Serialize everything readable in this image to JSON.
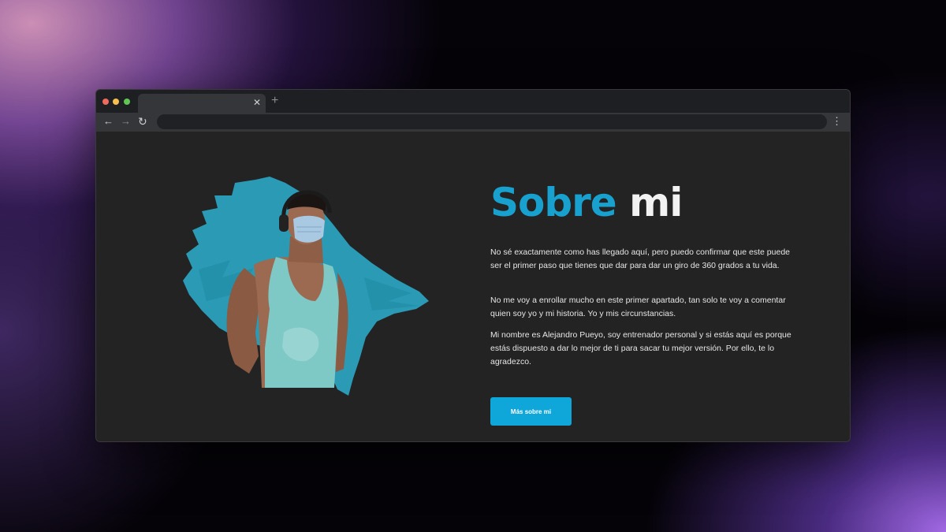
{
  "browser": {
    "tab_close_icon": "close-icon",
    "new_tab_icon": "plus-icon",
    "back_icon": "arrow-left-icon",
    "forward_icon": "arrow-right-icon",
    "reload_icon": "reload-icon",
    "menu_icon": "kebab-menu-icon",
    "tab_close_glyph": "✕",
    "new_tab_glyph": "+",
    "back_glyph": "←",
    "forward_glyph": "→",
    "reload_glyph": "↻",
    "menu_glyph": "⋮"
  },
  "about": {
    "title_part1": "Sobre",
    "title_part2": "mi",
    "paragraphs": [
      "No sé exactamente como has llegado aquí, pero puedo confirmar que este puede ser el primer paso que tienes que dar para dar un giro de 360 grados a tu vida.",
      "No me voy a enrollar mucho en este primer apartado, tan solo te voy a comentar quien soy yo y mi historia. Yo y mis circunstancias.",
      "Mi nombre es Alejandro Pueyo, soy entrenador personal y si estás aquí es porque estás dispuesto a dar lo mejor de ti para sacar tu mejor versión. Por ello, te lo agradezco."
    ],
    "button_label": "Más sobre mi",
    "image_icon": "trainer-photo",
    "accent_color": "#18a1cf",
    "button_color": "#0fa6da"
  }
}
